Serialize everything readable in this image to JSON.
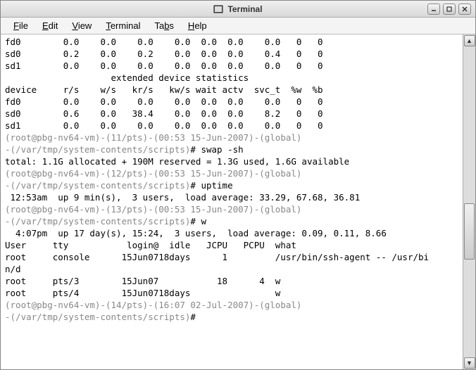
{
  "window": {
    "title": "Terminal"
  },
  "menu": {
    "file": "File",
    "edit": "Edit",
    "view": "View",
    "terminal": "Terminal",
    "tabs": "Tabs",
    "help": "Help"
  },
  "term": {
    "l01": "fd0        0.0    0.0    0.0    0.0  0.0  0.0    0.0   0   0",
    "l02": "sd0        0.2    0.0    0.2    0.0  0.0  0.0    0.4   0   0",
    "l03": "sd1        0.0    0.0    0.0    0.0  0.0  0.0    0.0   0   0",
    "l04": "                    extended device statistics",
    "l05": "device     r/s    w/s   kr/s   kw/s wait actv  svc_t  %w  %b",
    "l06": "fd0        0.0    0.0    0.0    0.0  0.0  0.0    0.0   0   0",
    "l07": "sd0        0.6    0.0   38.4    0.0  0.0  0.0    8.2   0   0",
    "l08": "sd1        0.0    0.0    0.0    0.0  0.0  0.0    0.0   0   0",
    "p1a": "(root@pbg-nv64-vm)-(11/pts)-(00:53 15-Jun-2007)-(global)",
    "p1b_pre": "-(/var/tmp/system-contents/scripts)",
    "p1b_cmd": "# swap -sh",
    "l11": "total: 1.1G allocated + 190M reserved = 1.3G used, 1.6G available",
    "p2a": "(root@pbg-nv64-vm)-(12/pts)-(00:53 15-Jun-2007)-(global)",
    "p2b_pre": "-(/var/tmp/system-contents/scripts)",
    "p2b_cmd": "# uptime",
    "l14": " 12:53am  up 9 min(s),  3 users,  load average: 33.29, 67.68, 36.81",
    "p3a": "(root@pbg-nv64-vm)-(13/pts)-(00:53 15-Jun-2007)-(global)",
    "p3b_pre": "-(/var/tmp/system-contents/scripts)",
    "p3b_cmd": "# w",
    "l17": "  4:07pm  up 17 day(s), 15:24,  3 users,  load average: 0.09, 0.11, 8.66",
    "l18": "User     tty           login@  idle   JCPU   PCPU  what",
    "l19": "root     console      15Jun0718days      1         /usr/bin/ssh-agent -- /usr/bi",
    "l20": "n/d",
    "l21": "root     pts/3        15Jun07           18      4  w",
    "l22": "root     pts/4        15Jun0718days                w",
    "p4a": "(root@pbg-nv64-vm)-(14/pts)-(16:07 02-Jul-2007)-(global)",
    "p4b_pre": "-(/var/tmp/system-contents/scripts)",
    "p4b_cmd": "# "
  }
}
